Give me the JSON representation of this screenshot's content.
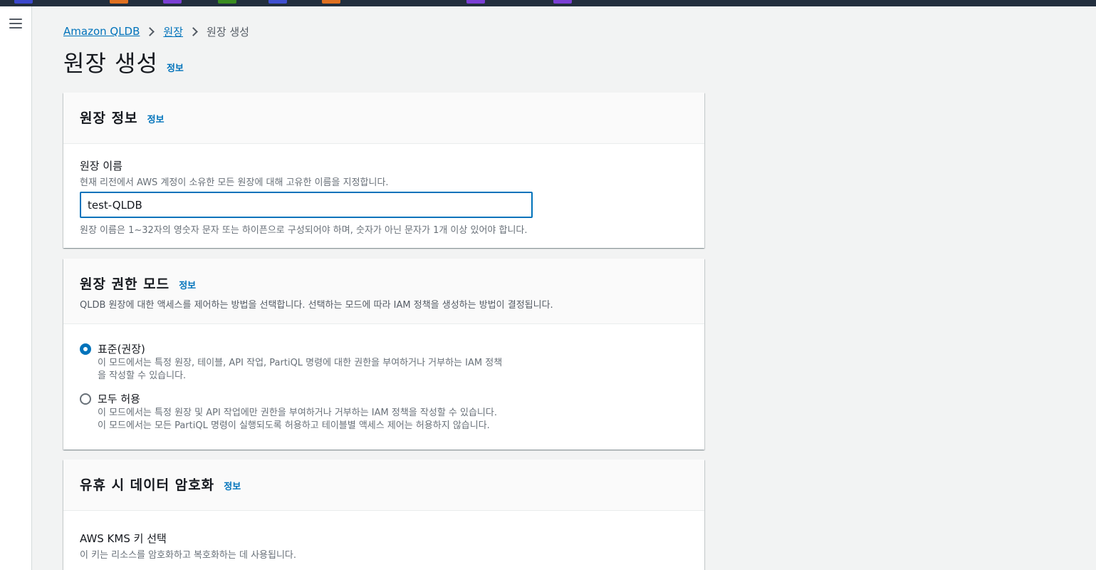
{
  "favicon_colors": [
    "#3b48cc",
    "#e07020",
    "#7b3fd4",
    "#3a8c20",
    "#4050d0",
    "#e07020",
    "#7b3fd4",
    "#7b3fd4"
  ],
  "breadcrumb": {
    "items": [
      "Amazon QLDB",
      "원장"
    ],
    "current": "원장 생성"
  },
  "page": {
    "title": "원장 생성",
    "info": "정보"
  },
  "ledger_info": {
    "title": "원장 정보",
    "info": "정보",
    "name_label": "원장 이름",
    "name_description": "현재 리전에서 AWS 계정이 소유한 모든 원장에 대해 고유한 이름을 지정합니다.",
    "name_value": "test-QLDB",
    "name_constraint": "원장 이름은 1~32자의 영숫자 문자 또는 하이픈으로 구성되어야 하며, 숫자가 아닌 문자가 1개 이상 있어야 합니다."
  },
  "permissions": {
    "title": "원장 권한 모드",
    "info": "정보",
    "description": "QLDB 원장에 대한 액세스를 제어하는 방법을 선택합니다. 선택하는 모드에 따라 IAM 정책을 생성하는 방법이 결정됩니다.",
    "options": [
      {
        "label": "표준(권장)",
        "selected": true,
        "desc_lines": [
          "이 모드에서는 특정 원장, 테이블, API 작업, PartiQL 명령에 대한 권한을 부여하거나 거부하는 IAM 정책",
          "을 작성할 수 있습니다."
        ]
      },
      {
        "label": "모두 허용",
        "selected": false,
        "desc_lines": [
          "이 모드에서는 특정 원장 및 API 작업에만 권한을 부여하거나 거부하는 IAM 정책을 작성할 수 있습니다.",
          "이 모드에서는 모든 PartiQL 명령이 실행되도록 허용하고 테이블별 액세스 제어는 허용하지 않습니다."
        ]
      }
    ]
  },
  "encryption": {
    "title": "유휴 시 데이터 암호화",
    "info": "정보",
    "kms_label": "AWS KMS 키 선택",
    "kms_description": "이 키는 리소스를 암호화하고 복호화하는 데 사용됩니다."
  }
}
